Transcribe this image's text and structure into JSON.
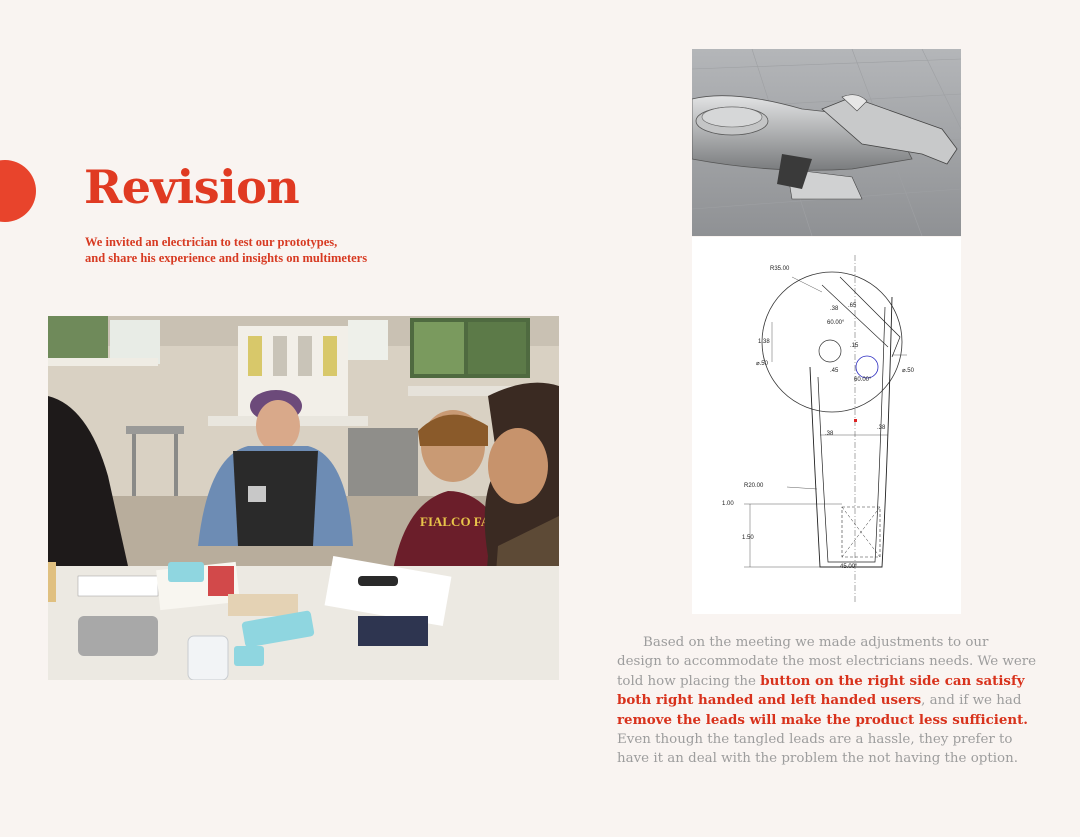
{
  "page": {
    "title": "Revision",
    "subtitle_lines": [
      "We invited an electrician to test our prototypes,",
      "and share his experience and insights on multimeters"
    ]
  },
  "photo": {
    "icon": "meeting-photo",
    "hoodie_text": "FIALCO FALCONS"
  },
  "render_3d": {
    "icon": "multimeter-3d-render"
  },
  "drawing": {
    "icon": "technical-drawing",
    "dimensions": [
      "R35.00",
      ".38",
      ".65",
      "60.00°",
      "1.38",
      ".15",
      "⌀.50",
      ".45",
      "60.00°",
      "⌀.50",
      ".38",
      ".38",
      "R20.00",
      "1.00",
      "1.50",
      "45.00°"
    ]
  },
  "body": {
    "p1": "Based on the meeting we made adjustments to our design to accommodate the most electricians needs. We were told how placing the ",
    "h1": "button on the right side can satisfy both right handed and left handed users",
    "p2": ", and if we had ",
    "h2": "remove the leads will make the product less sufficient.",
    "p3": " Even though the tangled leads are a hassle, they prefer to have it  an deal with the problem the not having the option."
  },
  "colors": {
    "accent": "#e8442c",
    "title": "#e03a22",
    "body_text": "#9d9d9d",
    "background": "#f9f4f1"
  }
}
